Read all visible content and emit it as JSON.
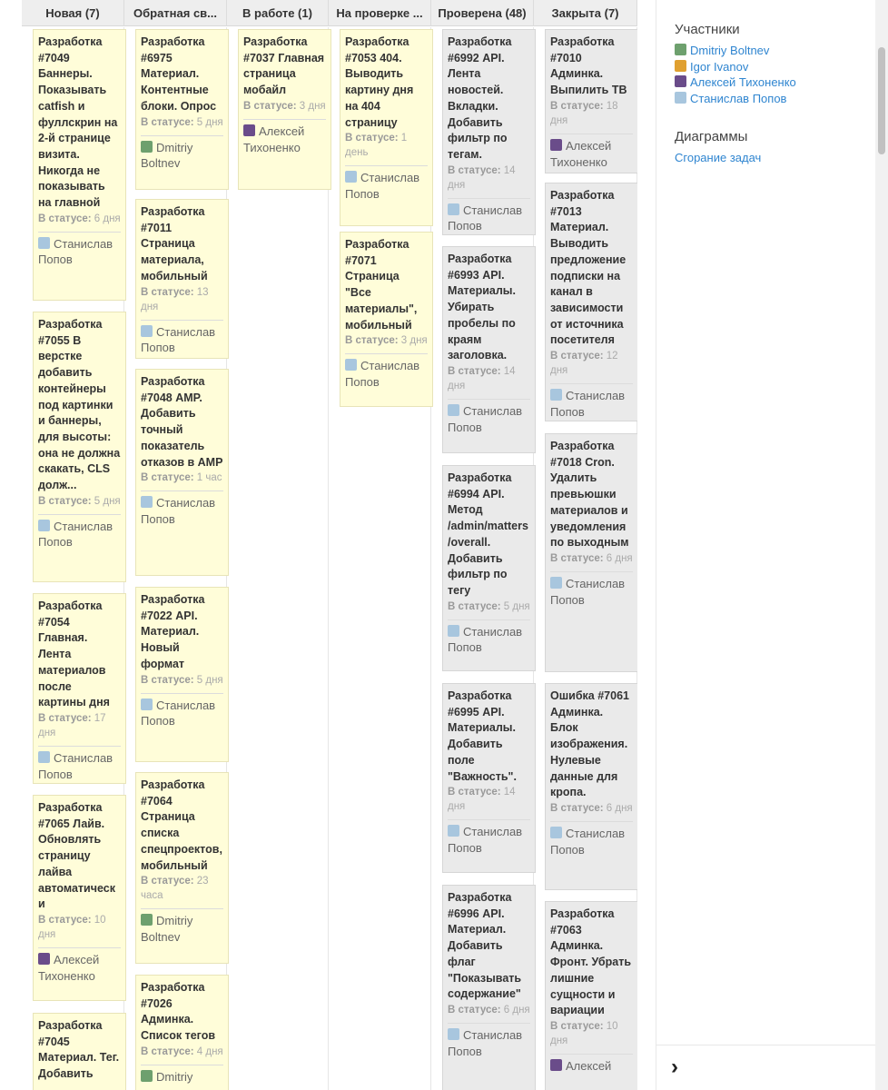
{
  "board": {
    "columns": [
      {
        "title": "Новая (7)",
        "cards": [
          {
            "title": "Разработка #7049 Баннеры. Показывать catfish и фуллскрин на 2-й странице визита. Никогда не показывать на главной",
            "status_label": "В статусе:",
            "status_value": "6 дня",
            "assignee": "Станислав Попов",
            "avatar": "stas"
          },
          {
            "title": "Разработка #7055 В верстке добавить контейнеры под картинки и баннеры, для высоты: она не должна скакать, CLS долж...",
            "status_label": "В статусе:",
            "status_value": "5 дня",
            "assignee": "Станислав Попов",
            "avatar": "stas"
          },
          {
            "title": "Разработка #7054 Главная. Лента материалов после картины дня",
            "status_label": "В статусе:",
            "status_value": "17 дня",
            "assignee": "Станислав Попов",
            "avatar": "stas"
          },
          {
            "title": "Разработка #7065 Лайв. Обновлять страницу лайва автоматически",
            "status_label": "В статусе:",
            "status_value": "10 дня",
            "assignee": "Алексей Тихоненко",
            "avatar": "alex"
          },
          {
            "title": "Разработка #7045 Материал. Тег. Добавить",
            "status_label": "",
            "status_value": "",
            "assignee": "",
            "avatar": ""
          }
        ]
      },
      {
        "title": "Обратная св...",
        "cards": [
          {
            "title": "Разработка #6975 Материал. Контентные блоки. Опрос",
            "status_label": "В статусе:",
            "status_value": "5 дня",
            "assignee": "Dmitriy Boltnev",
            "avatar": "dima"
          },
          {
            "title": "Разработка #7011 Страница материала, мобильный",
            "status_label": "В статусе:",
            "status_value": "13 дня",
            "assignee": "Станислав Попов",
            "avatar": "stas"
          },
          {
            "title": "Разработка #7048 AMP. Добавить точный показатель отказов в AMP",
            "status_label": "В статусе:",
            "status_value": "1 час",
            "assignee": "Станислав Попов",
            "avatar": "stas"
          },
          {
            "title": "Разработка #7022 API. Материал. Новый формат",
            "status_label": "В статусе:",
            "status_value": "5 дня",
            "assignee": "Станислав Попов",
            "avatar": "stas"
          },
          {
            "title": "Разработка #7064 Страница списка спецпроектов, мобильный",
            "status_label": "В статусе:",
            "status_value": "23 часа",
            "assignee": "Dmitriy Boltnev",
            "avatar": "dima"
          },
          {
            "title": "Разработка #7026 Админка. Список тегов",
            "status_label": "В статусе:",
            "status_value": "4 дня",
            "assignee": "Dmitriy",
            "avatar": "dima"
          }
        ]
      },
      {
        "title": "В работе (1)",
        "cards": [
          {
            "title": "Разработка #7037 Главная страница мобайл",
            "status_label": "В статусе:",
            "status_value": "3 дня",
            "assignee": "Алексей Тихоненко",
            "avatar": "alex"
          }
        ]
      },
      {
        "title": "На проверке ...",
        "cards": [
          {
            "title": "Разработка #7053 404. Выводить картину дня на 404 страницу",
            "status_label": "В статусе:",
            "status_value": "1 день",
            "assignee": "Станислав Попов",
            "avatar": "stas"
          },
          {
            "title": "Разработка #7071 Страница \"Все материалы\", мобильный",
            "status_label": "В статусе:",
            "status_value": "3 дня",
            "assignee": "Станислав Попов",
            "avatar": "stas"
          }
        ]
      },
      {
        "title": "Проверена (48)",
        "cards": [
          {
            "title": "Разработка #6992 API. Лента новостей. Вкладки. Добавить фильтр по тегам.",
            "status_label": "В статусе:",
            "status_value": "14 дня",
            "assignee": "Станислав Попов",
            "avatar": "stas"
          },
          {
            "title": "Разработка #6993 API. Материалы. Убирать пробелы по краям заголовка.",
            "status_label": "В статусе:",
            "status_value": "14 дня",
            "assignee": "Станислав Попов",
            "avatar": "stas"
          },
          {
            "title": "Разработка #6994 API. Метод /admin/matters/overall. Добавить фильтр по тегу",
            "status_label": "В статусе:",
            "status_value": "5 дня",
            "assignee": "Станислав Попов",
            "avatar": "stas"
          },
          {
            "title": "Разработка #6995 API. Материалы. Добавить поле \"Важность\".",
            "status_label": "В статусе:",
            "status_value": "14 дня",
            "assignee": "Станислав Попов",
            "avatar": "stas"
          },
          {
            "title": "Разработка #6996 API. Материал. Добавить флаг \"Показывать содержание\"",
            "status_label": "В статусе:",
            "status_value": "6 дня",
            "assignee": "Станислав Попов",
            "avatar": "stas"
          }
        ]
      },
      {
        "title": "Закрыта (7)",
        "cards": [
          {
            "title": "Разработка #7010 Админка. Выпилить ТВ",
            "status_label": "В статусе:",
            "status_value": "18 дня",
            "assignee": "Алексей Тихоненко",
            "avatar": "alex"
          },
          {
            "title": "Разработка #7013 Материал. Выводить предложение подписки на канал в зависимости от источника посетителя",
            "status_label": "В статусе:",
            "status_value": "12 дня",
            "assignee": "Станислав Попов",
            "avatar": "stas"
          },
          {
            "title": "Разработка #7018 Cron. Удалить превьюшки материалов и уведомления по выходным",
            "status_label": "В статусе:",
            "status_value": "6 дня",
            "assignee": "Станислав Попов",
            "avatar": "stas"
          },
          {
            "title": "Ошибка #7061 Админка. Блок изображения. Нулевые данные для кропа.",
            "status_label": "В статусе:",
            "status_value": "6 дня",
            "assignee": "Станислав Попов",
            "avatar": "stas"
          },
          {
            "title": "Разработка #7063 Админка. Фронт. Убрать лишние сущности и вариации",
            "status_label": "В статусе:",
            "status_value": "10 дня",
            "assignee": "Алексей",
            "avatar": "alex"
          }
        ]
      }
    ]
  },
  "sidebar": {
    "participants_title": "Участники",
    "participants": [
      {
        "name": "Dmitriy Boltnev",
        "avatar": "dima"
      },
      {
        "name": "Igor Ivanov",
        "avatar": "igor"
      },
      {
        "name": "Алексей Тихоненко",
        "avatar": "alex"
      },
      {
        "name": "Станислав Попов",
        "avatar": "stas"
      }
    ],
    "charts_title": "Диаграммы",
    "charts_link": "Сгорание задач",
    "collapse_icon": "chevron-right-icon"
  },
  "colors": {
    "card_open": "#fffdd9",
    "card_done": "#eaeaea",
    "link": "#2f85d0"
  }
}
